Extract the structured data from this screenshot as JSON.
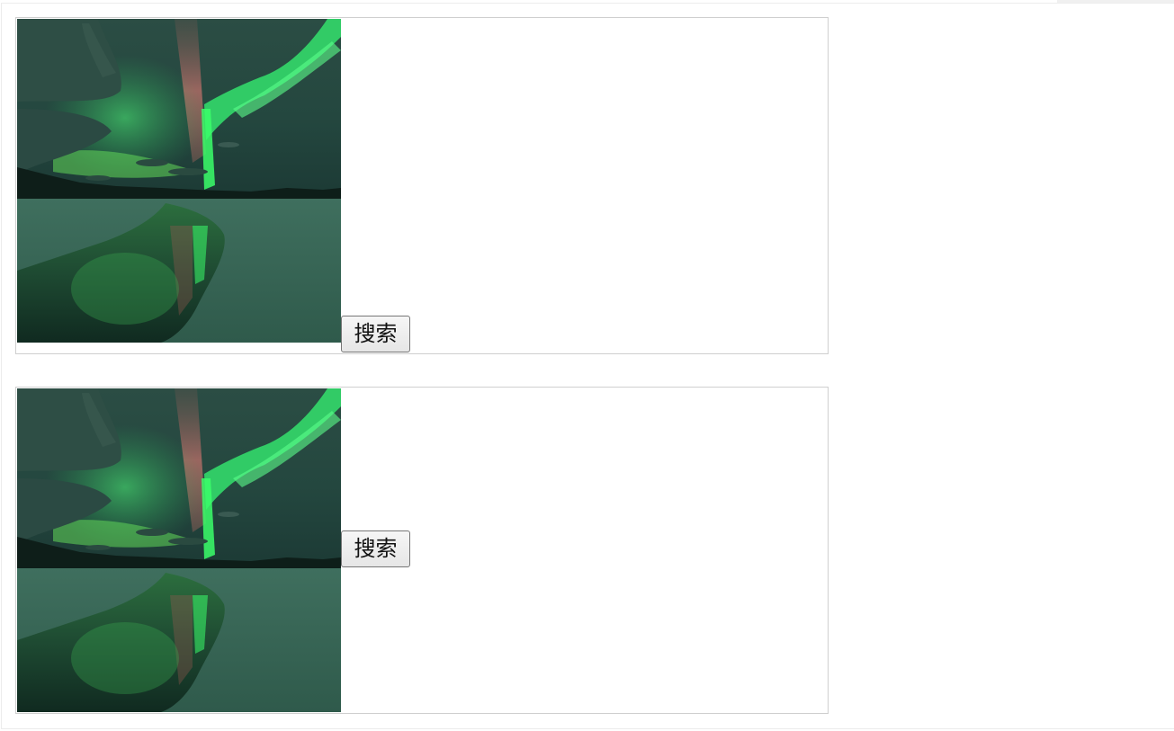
{
  "demos": [
    {
      "button_label": "搜索",
      "image": "aurora-landscape"
    },
    {
      "button_label": "搜索",
      "image": "aurora-landscape"
    }
  ],
  "colors": {
    "sky_dark": "#1e3a35",
    "aurora_green": "#2fdc6a",
    "aurora_pink": "#c0706a",
    "snow": "#3e6e5c",
    "border": "#cfcfcf"
  }
}
